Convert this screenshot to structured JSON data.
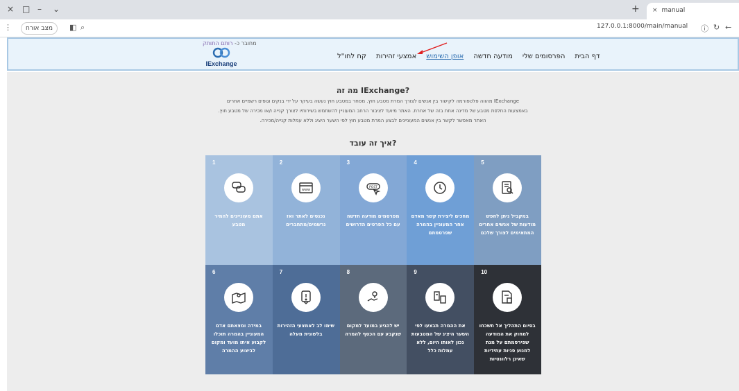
{
  "browser": {
    "window_controls": [
      "×",
      "□",
      "–",
      "⌄"
    ],
    "tab_title": "manual",
    "tab_close": "×",
    "new_tab": "+",
    "url": "127.0.0.1:8000/main/manual",
    "profile_label": "מצב אורח"
  },
  "site": {
    "user_line_prefix": "מחובר כ- ",
    "user_line_name": "רותם התותק",
    "logo_text": "IExchange",
    "nav": [
      {
        "label": "דף הבית",
        "active": false
      },
      {
        "label": "הפרסומים שלי",
        "active": false
      },
      {
        "label": "מודעה חדשה",
        "active": false
      },
      {
        "label": "אופן השימוש",
        "active": true
      },
      {
        "label": "אמצעי זהירות",
        "active": false
      },
      {
        "label": "קח לחו\"ל",
        "active": false
      }
    ]
  },
  "content": {
    "title1": "מה זה IExchange?",
    "para1": "IExchange מהווה פלטפורמה לקישור בין אנשים לצורך המרת מטבע חוץ. מסחר במטבע חוץ נעשה בעיקר על ידי בנקים וגופים רשמיים אחרים",
    "para2": "באמצעות החלפת מטבע של מדינה אחת בזה של אחרת. האתר מיועד לציבור הרחב המעוניין להשתמש בשירותיו לצורך קנייה ו/או מכירה של מטבע חוץ.",
    "para3": "האתר מאפשר לקשר בין אנשים המעוניינים לבצע המרת מטבע חוץ לפי השער היציג וללא עמלות קנייה/מכירה.",
    "title2": "איך זה עובד?"
  },
  "steps": [
    {
      "num": "1",
      "icon": "chat-bubbles-icon",
      "text": "אתם מעוניינים להמיר מטבע",
      "color": "#a9c3e0"
    },
    {
      "num": "2",
      "icon": "browser-www-icon",
      "text": "נכנסים לאתר ואז נרשמים/מתחברים",
      "color": "#92b3d9"
    },
    {
      "num": "3",
      "icon": "post-click-icon",
      "text": "מפרסמים מודעה חדשה עם כל הפרטים הדרושים",
      "color": "#83a8d6"
    },
    {
      "num": "4",
      "icon": "clock-icon",
      "text": "מחכים ליצירת קשר מאדם אחר המעוניין בהמרה שפרסמתם",
      "color": "#6f9fd6"
    },
    {
      "num": "5",
      "icon": "document-search-icon",
      "text": "במקביל ניתן לחפש מודעות של אנשים אחרים המתאימים לצורך שלכם",
      "color": "#7f9ec2"
    },
    {
      "num": "6",
      "icon": "map-pin-icon",
      "text": "במידה ומצאתם אדם המעוניין בהמרה תוכלו לקבוע איתו מועד ומקום לביצוע ההמרה",
      "color": "#5f7ea8"
    },
    {
      "num": "7",
      "icon": "warning-tag-icon",
      "text": "שימו לב לאמצעי הזהירות בלשונית מעלה",
      "color": "#4e6d97"
    },
    {
      "num": "8",
      "icon": "location-handshake-icon",
      "text": "יש להגיע במועד למקום שנקבע עם הכסף להמרה",
      "color": "#5c6a7c"
    },
    {
      "num": "9",
      "icon": "exchange-rate-icon",
      "text": "את ההמרה תבצעו לפי השער היציג של המטבעות נכון לאותו היום, ללא עמלות כלל",
      "color": "#434f62"
    },
    {
      "num": "10",
      "icon": "delete-document-icon",
      "text": "בסיום התהליך אל תשכחו למחוק את המודעה שפירסמתם על מנת למנוע פניות עתידיות שאינן רלוונטיות",
      "color": "#2e3137"
    }
  ]
}
